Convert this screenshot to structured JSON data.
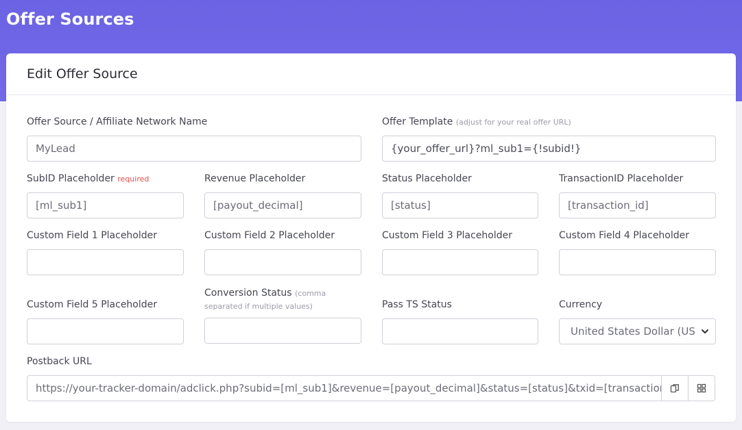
{
  "page": {
    "title": "Offer Sources"
  },
  "card": {
    "title": "Edit Offer Source"
  },
  "form": {
    "network_name": {
      "label": "Offer Source / Affiliate Network Name",
      "value": "MyLead"
    },
    "offer_template": {
      "label": "Offer Template",
      "hint": "(adjust for your real offer URL)",
      "value": "{your_offer_url}?ml_sub1={!subid!}"
    },
    "subid": {
      "label": "SubID Placeholder",
      "required": "required",
      "value": "[ml_sub1]"
    },
    "revenue": {
      "label": "Revenue Placeholder",
      "value": "[payout_decimal]"
    },
    "status": {
      "label": "Status Placeholder",
      "value": "[status]"
    },
    "transaction": {
      "label": "TransactionID Placeholder",
      "value": "[transaction_id]"
    },
    "custom1": {
      "label": "Custom Field 1 Placeholder",
      "value": ""
    },
    "custom2": {
      "label": "Custom Field 2 Placeholder",
      "value": ""
    },
    "custom3": {
      "label": "Custom Field 3 Placeholder",
      "value": ""
    },
    "custom4": {
      "label": "Custom Field 4 Placeholder",
      "value": ""
    },
    "custom5": {
      "label": "Custom Field 5 Placeholder",
      "value": ""
    },
    "conversion_status": {
      "label": "Conversion Status",
      "hint_line1": "(comma",
      "hint_line2": "separated if multiple values)",
      "value": ""
    },
    "pass_ts": {
      "label": "Pass TS Status",
      "value": ""
    },
    "currency": {
      "label": "Currency",
      "value": "United States Dollar (US"
    },
    "postback": {
      "label": "Postback URL",
      "value": "https://your-tracker-domain/adclick.php?subid=[ml_sub1]&revenue=[payout_decimal]&status=[status]&txid=[transaction_id]"
    }
  },
  "icons": {
    "copy": "copy-icon",
    "qr": "qr-code-icon",
    "select": "chevron-down-icon"
  },
  "colors": {
    "header_band": "#6c63e4",
    "required": "#e74c4c",
    "border": "#cfd0d9"
  }
}
